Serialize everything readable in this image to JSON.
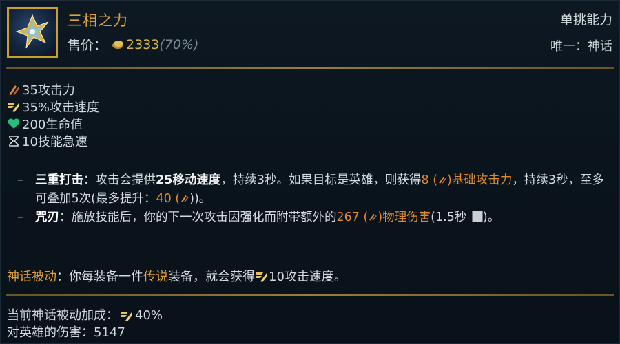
{
  "item": {
    "name": "三相之力",
    "price_label": "售价：",
    "price_value": "2333",
    "price_percent": "(70%)",
    "category": "单挑能力",
    "unique": "唯一：神话",
    "icon": "trinity-force-icon"
  },
  "stats": [
    {
      "icon": "attack-damage-icon",
      "text": "35攻击力"
    },
    {
      "icon": "attack-speed-icon",
      "text": "35%攻击速度"
    },
    {
      "icon": "health-icon",
      "text": "200生命值"
    },
    {
      "icon": "ability-haste-icon",
      "text": "10技能急速"
    }
  ],
  "passives": {
    "p1": {
      "name": "三重打击",
      "colon": "：",
      "t1": "攻击会提供",
      "t2": "25移动速度",
      "t3": "，持续3秒。如果目标是英雄，则获得",
      "t4": "8",
      "t5": "(",
      "t6": ")基础攻击力",
      "t7": "，持续3秒，至多可叠加5次(最多提升：",
      "t8": "40",
      "t9": "(",
      "t10": "))。"
    },
    "p2": {
      "name": "咒刃",
      "colon": "：",
      "t1": "施放技能后，你的下一次攻击因强化而附带额外的",
      "t2": "267",
      "t3": "(",
      "t4": ")物理伤害",
      "t5": "(1.5秒",
      "t6": ")。"
    }
  },
  "mythic": {
    "label": "神话被动",
    "colon": "：",
    "t1": "你每装备一件",
    "t2": "传说",
    "t3": "装备，就会获得",
    "t4": "10攻击速度。"
  },
  "footer": {
    "bonus_label": "当前神话被动加成：",
    "bonus_value": "40%",
    "damage_label": "对英雄的伤害：",
    "damage_value": "5147"
  },
  "colors": {
    "gold": "#e0a13c",
    "orange": "#e08a30",
    "text": "#d2dbe0",
    "health": "#27c07a",
    "background": "#0b141c"
  }
}
